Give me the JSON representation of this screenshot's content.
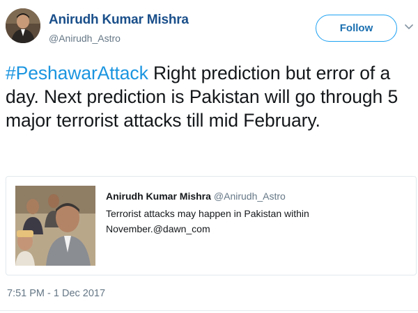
{
  "author": {
    "name": "Anirudh Kumar Mishra",
    "handle": "@Anirudh_Astro"
  },
  "follow_button": {
    "label": "Follow",
    "accent_color": "#1da1f2"
  },
  "caret_icon": "chevron-down-icon",
  "tweet": {
    "hashtag": "#PeshawarAttack",
    "text": " Right prediction but error of a day. Next prediction is Pakistan will go through 5 major terrorist attacks till mid February.",
    "timestamp": "7:51 PM - 1 Dec 2017"
  },
  "quoted_tweet": {
    "name": "Anirudh Kumar Mishra",
    "handle": "@Anirudh_Astro",
    "text": "Terrorist attacks may happen in Pakistan within November.@dawn_com"
  },
  "colors": {
    "name": "#1a4f8a",
    "hashtag": "#1b95e0",
    "secondary": "#657786"
  }
}
